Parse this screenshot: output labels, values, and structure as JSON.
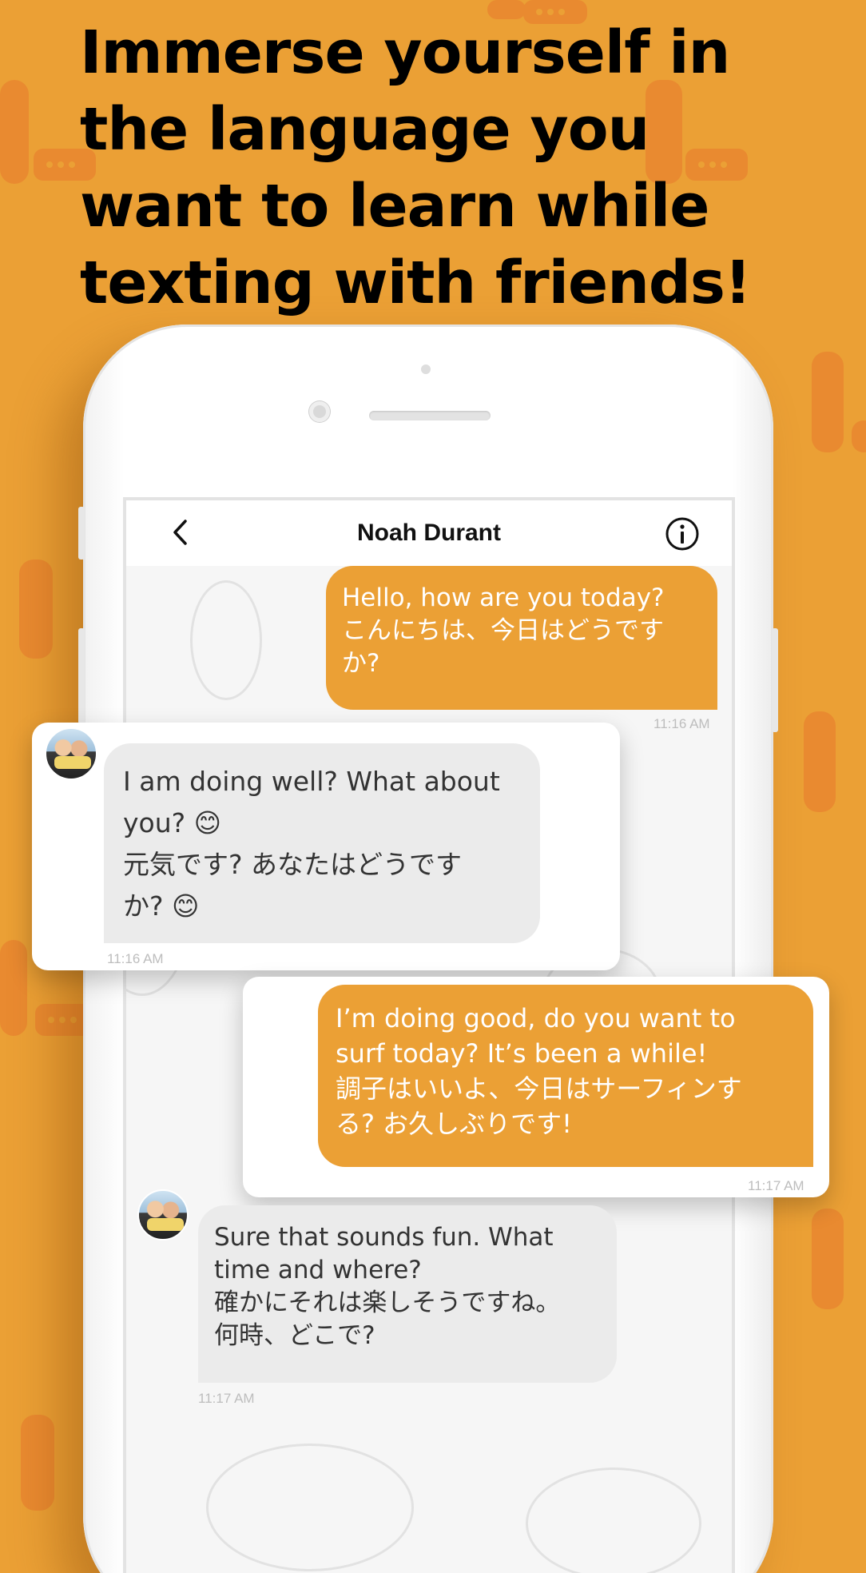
{
  "headline": {
    "line1": "Immerse yourself in",
    "line2": "the language you",
    "line3": "want to learn while",
    "line4": "texting with friends!"
  },
  "chat": {
    "contact_name": "Noah Durant",
    "back_icon": "chevron-left-icon",
    "info_icon": "info-icon"
  },
  "messages": [
    {
      "direction": "outgoing",
      "lines": [
        "Hello, how are you today?",
        "こんにちは、今日はどうです",
        "か?"
      ],
      "time": "11:16 AM"
    },
    {
      "direction": "incoming",
      "lines": [
        "I am doing well?  What about",
        "you? 😊",
        "元気です? あなたはどうです",
        "か? 😊"
      ],
      "time": "11:16 AM"
    },
    {
      "direction": "outgoing",
      "lines": [
        "I’m doing good, do you want to",
        "surf today?  It’s been a while!",
        "調子はいいよ、今日はサーフィンす",
        "る? お久しぶりです!"
      ],
      "time": "11:17 AM"
    },
    {
      "direction": "incoming",
      "lines": [
        "Sure that sounds fun.  What",
        "time and where?",
        "確かにそれは楽しそうですね。",
        "何時、どこで?"
      ],
      "time": "11:17 AM"
    }
  ],
  "colors": {
    "background": "#EBA035",
    "accent": "#EBA035",
    "incoming_bubble": "#EBEBEB"
  }
}
